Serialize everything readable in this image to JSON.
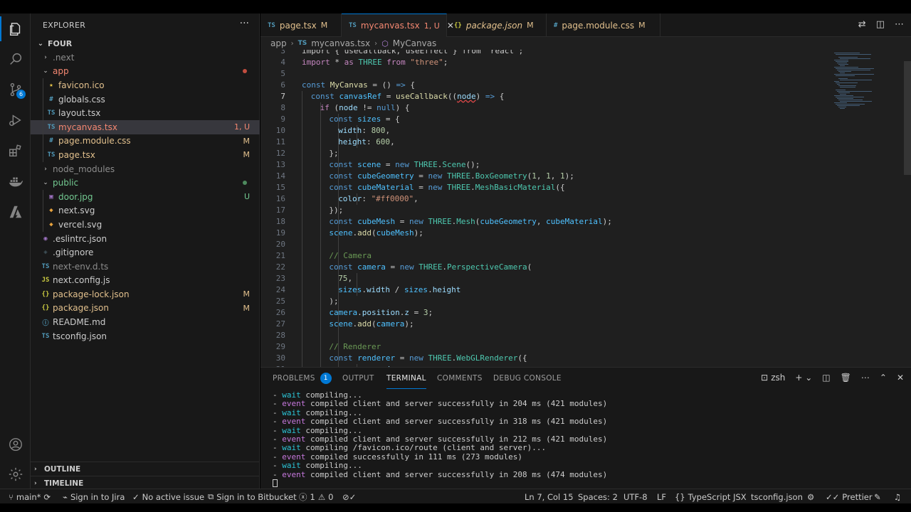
{
  "sidebar": {
    "title": "EXPLORER",
    "more": "···",
    "root": "FOUR",
    "items": [
      {
        "label": ".next",
        "kind": "folder",
        "open": false,
        "depth": 1,
        "color": "#8c8c8c"
      },
      {
        "label": "app",
        "kind": "folder",
        "open": true,
        "depth": 1,
        "color": "#f48771",
        "dot": "#c24d3f"
      },
      {
        "label": "favicon.ico",
        "kind": "file",
        "icon": "★",
        "iconColor": "#e8c547",
        "depth": 2,
        "color": "#e2c08d"
      },
      {
        "label": "globals.css",
        "kind": "file",
        "icon": "#",
        "iconColor": "#519aba",
        "depth": 2,
        "color": "#cccccc"
      },
      {
        "label": "layout.tsx",
        "kind": "file",
        "icon": "TS",
        "iconColor": "#519aba",
        "depth": 2,
        "color": "#cccccc"
      },
      {
        "label": "mycanvas.tsx",
        "kind": "file",
        "icon": "TS",
        "iconColor": "#519aba",
        "depth": 2,
        "color": "#f48771",
        "deco": "1, U",
        "decoColor": "#f48771",
        "selected": true
      },
      {
        "label": "page.module.css",
        "kind": "file",
        "icon": "#",
        "iconColor": "#519aba",
        "depth": 2,
        "color": "#e2c08d",
        "deco": "M",
        "decoColor": "#e2c08d"
      },
      {
        "label": "page.tsx",
        "kind": "file",
        "icon": "TS",
        "iconColor": "#519aba",
        "depth": 2,
        "color": "#e2c08d",
        "deco": "M",
        "decoColor": "#e2c08d"
      },
      {
        "label": "node_modules",
        "kind": "folder",
        "open": false,
        "depth": 1,
        "color": "#8c8c8c"
      },
      {
        "label": "public",
        "kind": "folder",
        "open": true,
        "depth": 1,
        "color": "#73c991",
        "dot": "#4e8a5e"
      },
      {
        "label": "door.jpg",
        "kind": "file",
        "icon": "▣",
        "iconColor": "#a074c4",
        "depth": 2,
        "color": "#73c991",
        "deco": "U",
        "decoColor": "#73c991"
      },
      {
        "label": "next.svg",
        "kind": "file",
        "icon": "◆",
        "iconColor": "#e8a33d",
        "depth": 2,
        "color": "#cccccc"
      },
      {
        "label": "vercel.svg",
        "kind": "file",
        "icon": "◆",
        "iconColor": "#e8a33d",
        "depth": 2,
        "color": "#cccccc"
      },
      {
        "label": ".eslintrc.json",
        "kind": "file",
        "icon": "◉",
        "iconColor": "#a074c4",
        "depth": 1,
        "color": "#cccccc"
      },
      {
        "label": ".gitignore",
        "kind": "file",
        "icon": "◈",
        "iconColor": "#41535b",
        "depth": 1,
        "color": "#cccccc"
      },
      {
        "label": "next-env.d.ts",
        "kind": "file",
        "icon": "TS",
        "iconColor": "#519aba",
        "depth": 1,
        "color": "#8c8c8c"
      },
      {
        "label": "next.config.js",
        "kind": "file",
        "icon": "JS",
        "iconColor": "#cbcb41",
        "depth": 1,
        "color": "#cccccc"
      },
      {
        "label": "package-lock.json",
        "kind": "file",
        "icon": "{}",
        "iconColor": "#cbcb41",
        "depth": 1,
        "color": "#e2c08d",
        "deco": "M",
        "decoColor": "#e2c08d"
      },
      {
        "label": "package.json",
        "kind": "file",
        "icon": "{}",
        "iconColor": "#cbcb41",
        "depth": 1,
        "color": "#e2c08d",
        "deco": "M",
        "decoColor": "#e2c08d"
      },
      {
        "label": "README.md",
        "kind": "file",
        "icon": "ⓘ",
        "iconColor": "#519aba",
        "depth": 1,
        "color": "#cccccc"
      },
      {
        "label": "tsconfig.json",
        "kind": "file",
        "icon": "TS",
        "iconColor": "#519aba",
        "depth": 1,
        "color": "#cccccc"
      }
    ],
    "outline": "OUTLINE",
    "timeline": "TIMELINE"
  },
  "activity": {
    "source_control_badge": "6"
  },
  "tabs": [
    {
      "icon": "TS",
      "label": "page.tsx",
      "mark": "M",
      "color": "#e2c08d"
    },
    {
      "icon": "TS",
      "label": "mycanvas.tsx",
      "mark": "1, U",
      "color": "#f48771",
      "active": true
    },
    {
      "icon": "{}",
      "label": "package.json",
      "mark": "M",
      "color": "#e2c08d"
    },
    {
      "icon": "#",
      "label": "page.module.css",
      "mark": "M",
      "color": "#e2c08d"
    }
  ],
  "breadcrumb": {
    "folder": "app",
    "file": "mycanvas.tsx",
    "symbol": "MyCanvas"
  },
  "code": {
    "current_line": 7,
    "lines": [
      {
        "n": 3,
        "indent": 0,
        "tokens": [
          [
            "import { useCallback, useEffect } from \"react\";",
            "#cccccc"
          ]
        ]
      },
      {
        "n": 4,
        "indent": 0,
        "tokens": [
          [
            "import",
            "#c586c0"
          ],
          [
            " * ",
            "#cccccc"
          ],
          [
            "as",
            "#c586c0"
          ],
          [
            " THREE ",
            "#4ec9b0"
          ],
          [
            "from",
            "#c586c0"
          ],
          [
            " \"three\"",
            "#ce9178"
          ],
          [
            ";",
            "#cccccc"
          ]
        ]
      },
      {
        "n": 5,
        "indent": 0,
        "tokens": []
      },
      {
        "n": 6,
        "indent": 0,
        "tokens": [
          [
            "const",
            "#569cd6"
          ],
          [
            " MyCanvas",
            "#dcdcaa"
          ],
          [
            " = () ",
            "#cccccc"
          ],
          [
            "=>",
            "#569cd6"
          ],
          [
            " {",
            "#cccccc"
          ]
        ]
      },
      {
        "n": 7,
        "indent": 1,
        "tokens": [
          [
            "const",
            "#569cd6"
          ],
          [
            " canvasRef",
            "#4fc1ff"
          ],
          [
            " = ",
            "#cccccc"
          ],
          [
            "useCallback",
            "#dcdcaa"
          ],
          [
            "((",
            "#cccccc"
          ],
          [
            "node",
            "#9cdcfe"
          ],
          [
            ") ",
            "#cccccc"
          ],
          [
            "=>",
            "#569cd6"
          ],
          [
            " {",
            "#cccccc"
          ]
        ]
      },
      {
        "n": 8,
        "indent": 2,
        "tokens": [
          [
            "if",
            "#c586c0"
          ],
          [
            " (",
            "#cccccc"
          ],
          [
            "node",
            "#9cdcfe"
          ],
          [
            " != ",
            "#cccccc"
          ],
          [
            "null",
            "#569cd6"
          ],
          [
            ") {",
            "#cccccc"
          ]
        ]
      },
      {
        "n": 9,
        "indent": 3,
        "tokens": [
          [
            "const",
            "#569cd6"
          ],
          [
            " sizes",
            "#4fc1ff"
          ],
          [
            " = {",
            "#cccccc"
          ]
        ]
      },
      {
        "n": 10,
        "indent": 4,
        "tokens": [
          [
            "width",
            "#9cdcfe"
          ],
          [
            ": ",
            "#cccccc"
          ],
          [
            "800",
            "#b5cea8"
          ],
          [
            ",",
            "#cccccc"
          ]
        ]
      },
      {
        "n": 11,
        "indent": 4,
        "tokens": [
          [
            "height",
            "#9cdcfe"
          ],
          [
            ": ",
            "#cccccc"
          ],
          [
            "600",
            "#b5cea8"
          ],
          [
            ",",
            "#cccccc"
          ]
        ]
      },
      {
        "n": 12,
        "indent": 3,
        "tokens": [
          [
            "};",
            "#cccccc"
          ]
        ]
      },
      {
        "n": 13,
        "indent": 3,
        "tokens": [
          [
            "const",
            "#569cd6"
          ],
          [
            " scene",
            "#4fc1ff"
          ],
          [
            " = ",
            "#cccccc"
          ],
          [
            "new",
            "#569cd6"
          ],
          [
            " THREE",
            "#4ec9b0"
          ],
          [
            ".",
            "#cccccc"
          ],
          [
            "Scene",
            "#4ec9b0"
          ],
          [
            "();",
            "#cccccc"
          ]
        ]
      },
      {
        "n": 14,
        "indent": 3,
        "tokens": [
          [
            "const",
            "#569cd6"
          ],
          [
            " cubeGeometry",
            "#4fc1ff"
          ],
          [
            " = ",
            "#cccccc"
          ],
          [
            "new",
            "#569cd6"
          ],
          [
            " THREE",
            "#4ec9b0"
          ],
          [
            ".",
            "#cccccc"
          ],
          [
            "BoxGeometry",
            "#4ec9b0"
          ],
          [
            "(",
            "#cccccc"
          ],
          [
            "1",
            "#b5cea8"
          ],
          [
            ", ",
            "#cccccc"
          ],
          [
            "1",
            "#b5cea8"
          ],
          [
            ", ",
            "#cccccc"
          ],
          [
            "1",
            "#b5cea8"
          ],
          [
            ");",
            "#cccccc"
          ]
        ]
      },
      {
        "n": 15,
        "indent": 3,
        "tokens": [
          [
            "const",
            "#569cd6"
          ],
          [
            " cubeMaterial",
            "#4fc1ff"
          ],
          [
            " = ",
            "#cccccc"
          ],
          [
            "new",
            "#569cd6"
          ],
          [
            " THREE",
            "#4ec9b0"
          ],
          [
            ".",
            "#cccccc"
          ],
          [
            "MeshBasicMaterial",
            "#4ec9b0"
          ],
          [
            "({",
            "#cccccc"
          ]
        ]
      },
      {
        "n": 16,
        "indent": 4,
        "tokens": [
          [
            "color",
            "#9cdcfe"
          ],
          [
            ": ",
            "#cccccc"
          ],
          [
            "\"#ff0000\"",
            "#ce9178"
          ],
          [
            ",",
            "#cccccc"
          ]
        ]
      },
      {
        "n": 17,
        "indent": 3,
        "tokens": [
          [
            "});",
            "#cccccc"
          ]
        ]
      },
      {
        "n": 18,
        "indent": 3,
        "tokens": [
          [
            "const",
            "#569cd6"
          ],
          [
            " cubeMesh",
            "#4fc1ff"
          ],
          [
            " = ",
            "#cccccc"
          ],
          [
            "new",
            "#569cd6"
          ],
          [
            " THREE",
            "#4ec9b0"
          ],
          [
            ".",
            "#cccccc"
          ],
          [
            "Mesh",
            "#4ec9b0"
          ],
          [
            "(",
            "#cccccc"
          ],
          [
            "cubeGeometry",
            "#4fc1ff"
          ],
          [
            ", ",
            "#cccccc"
          ],
          [
            "cubeMaterial",
            "#4fc1ff"
          ],
          [
            ");",
            "#cccccc"
          ]
        ]
      },
      {
        "n": 19,
        "indent": 3,
        "tokens": [
          [
            "scene",
            "#4fc1ff"
          ],
          [
            ".",
            "#cccccc"
          ],
          [
            "add",
            "#dcdcaa"
          ],
          [
            "(",
            "#cccccc"
          ],
          [
            "cubeMesh",
            "#4fc1ff"
          ],
          [
            ");",
            "#cccccc"
          ]
        ]
      },
      {
        "n": 20,
        "indent": 3,
        "tokens": []
      },
      {
        "n": 21,
        "indent": 3,
        "tokens": [
          [
            "// Camera",
            "#6a9955"
          ]
        ]
      },
      {
        "n": 22,
        "indent": 3,
        "tokens": [
          [
            "const",
            "#569cd6"
          ],
          [
            " camera",
            "#4fc1ff"
          ],
          [
            " = ",
            "#cccccc"
          ],
          [
            "new",
            "#569cd6"
          ],
          [
            " THREE",
            "#4ec9b0"
          ],
          [
            ".",
            "#cccccc"
          ],
          [
            "PerspectiveCamera",
            "#4ec9b0"
          ],
          [
            "(",
            "#cccccc"
          ]
        ]
      },
      {
        "n": 23,
        "indent": 4,
        "tokens": [
          [
            "75",
            "#b5cea8"
          ],
          [
            ",",
            "#cccccc"
          ]
        ]
      },
      {
        "n": 24,
        "indent": 4,
        "tokens": [
          [
            "sizes",
            "#4fc1ff"
          ],
          [
            ".",
            "#cccccc"
          ],
          [
            "width",
            "#9cdcfe"
          ],
          [
            " / ",
            "#cccccc"
          ],
          [
            "sizes",
            "#4fc1ff"
          ],
          [
            ".",
            "#cccccc"
          ],
          [
            "height",
            "#9cdcfe"
          ]
        ]
      },
      {
        "n": 25,
        "indent": 3,
        "tokens": [
          [
            ");",
            "#cccccc"
          ]
        ]
      },
      {
        "n": 26,
        "indent": 3,
        "tokens": [
          [
            "camera",
            "#4fc1ff"
          ],
          [
            ".",
            "#cccccc"
          ],
          [
            "position",
            "#9cdcfe"
          ],
          [
            ".",
            "#cccccc"
          ],
          [
            "z",
            "#9cdcfe"
          ],
          [
            " = ",
            "#cccccc"
          ],
          [
            "3",
            "#b5cea8"
          ],
          [
            ";",
            "#cccccc"
          ]
        ]
      },
      {
        "n": 27,
        "indent": 3,
        "tokens": [
          [
            "scene",
            "#4fc1ff"
          ],
          [
            ".",
            "#cccccc"
          ],
          [
            "add",
            "#dcdcaa"
          ],
          [
            "(",
            "#cccccc"
          ],
          [
            "camera",
            "#4fc1ff"
          ],
          [
            ");",
            "#cccccc"
          ]
        ]
      },
      {
        "n": 28,
        "indent": 3,
        "tokens": []
      },
      {
        "n": 29,
        "indent": 3,
        "tokens": [
          [
            "// Renderer",
            "#6a9955"
          ]
        ]
      },
      {
        "n": 30,
        "indent": 3,
        "tokens": [
          [
            "const",
            "#569cd6"
          ],
          [
            " renderer",
            "#4fc1ff"
          ],
          [
            " = ",
            "#cccccc"
          ],
          [
            "new",
            "#569cd6"
          ],
          [
            " THREE",
            "#4ec9b0"
          ],
          [
            ".",
            "#cccccc"
          ],
          [
            "WebGLRenderer",
            "#4ec9b0"
          ],
          [
            "({",
            "#cccccc"
          ]
        ]
      },
      {
        "n": 31,
        "indent": 4,
        "tokens": [
          [
            "canvas",
            "#9cdcfe"
          ],
          [
            ": ",
            "#cccccc"
          ],
          [
            "node",
            "#9cdcfe"
          ]
        ]
      }
    ]
  },
  "panel": {
    "tabs": [
      "PROBLEMS",
      "OUTPUT",
      "TERMINAL",
      "COMMENTS",
      "DEBUG CONSOLE"
    ],
    "problems_badge": "1",
    "active_tab": "TERMINAL",
    "shell": "zsh",
    "terminal": [
      {
        "kind": "wait",
        "text": "compiling..."
      },
      {
        "kind": "event",
        "text": "compiled client and server successfully in 204 ms (421 modules)"
      },
      {
        "kind": "wait",
        "text": "compiling..."
      },
      {
        "kind": "event",
        "text": "compiled client and server successfully in 318 ms (421 modules)"
      },
      {
        "kind": "wait",
        "text": "compiling..."
      },
      {
        "kind": "event",
        "text": "compiled client and server successfully in 212 ms (421 modules)"
      },
      {
        "kind": "wait",
        "text": "compiling /favicon.ico/route (client and server)..."
      },
      {
        "kind": "event",
        "text": "compiled successfully in 111 ms (273 modules)"
      },
      {
        "kind": "wait",
        "text": "compiling..."
      },
      {
        "kind": "event",
        "text": "compiled client and server successfully in 208 ms (474 modules)"
      }
    ],
    "colors": {
      "wait": "#2bc4d6",
      "event": "#c678dd"
    }
  },
  "status": {
    "branch": "main*",
    "jira": "Sign in to Jira",
    "issue": "No active issue",
    "bitbucket": "Sign in to Bitbucket",
    "errors": "1",
    "warnings": "0",
    "position": "Ln 7, Col 15",
    "spaces": "Spaces: 2",
    "encoding": "UTF-8",
    "eol": "LF",
    "language": "TypeScript JSX",
    "tsconfig": "tsconfig.json",
    "prettier": "Prettier"
  }
}
